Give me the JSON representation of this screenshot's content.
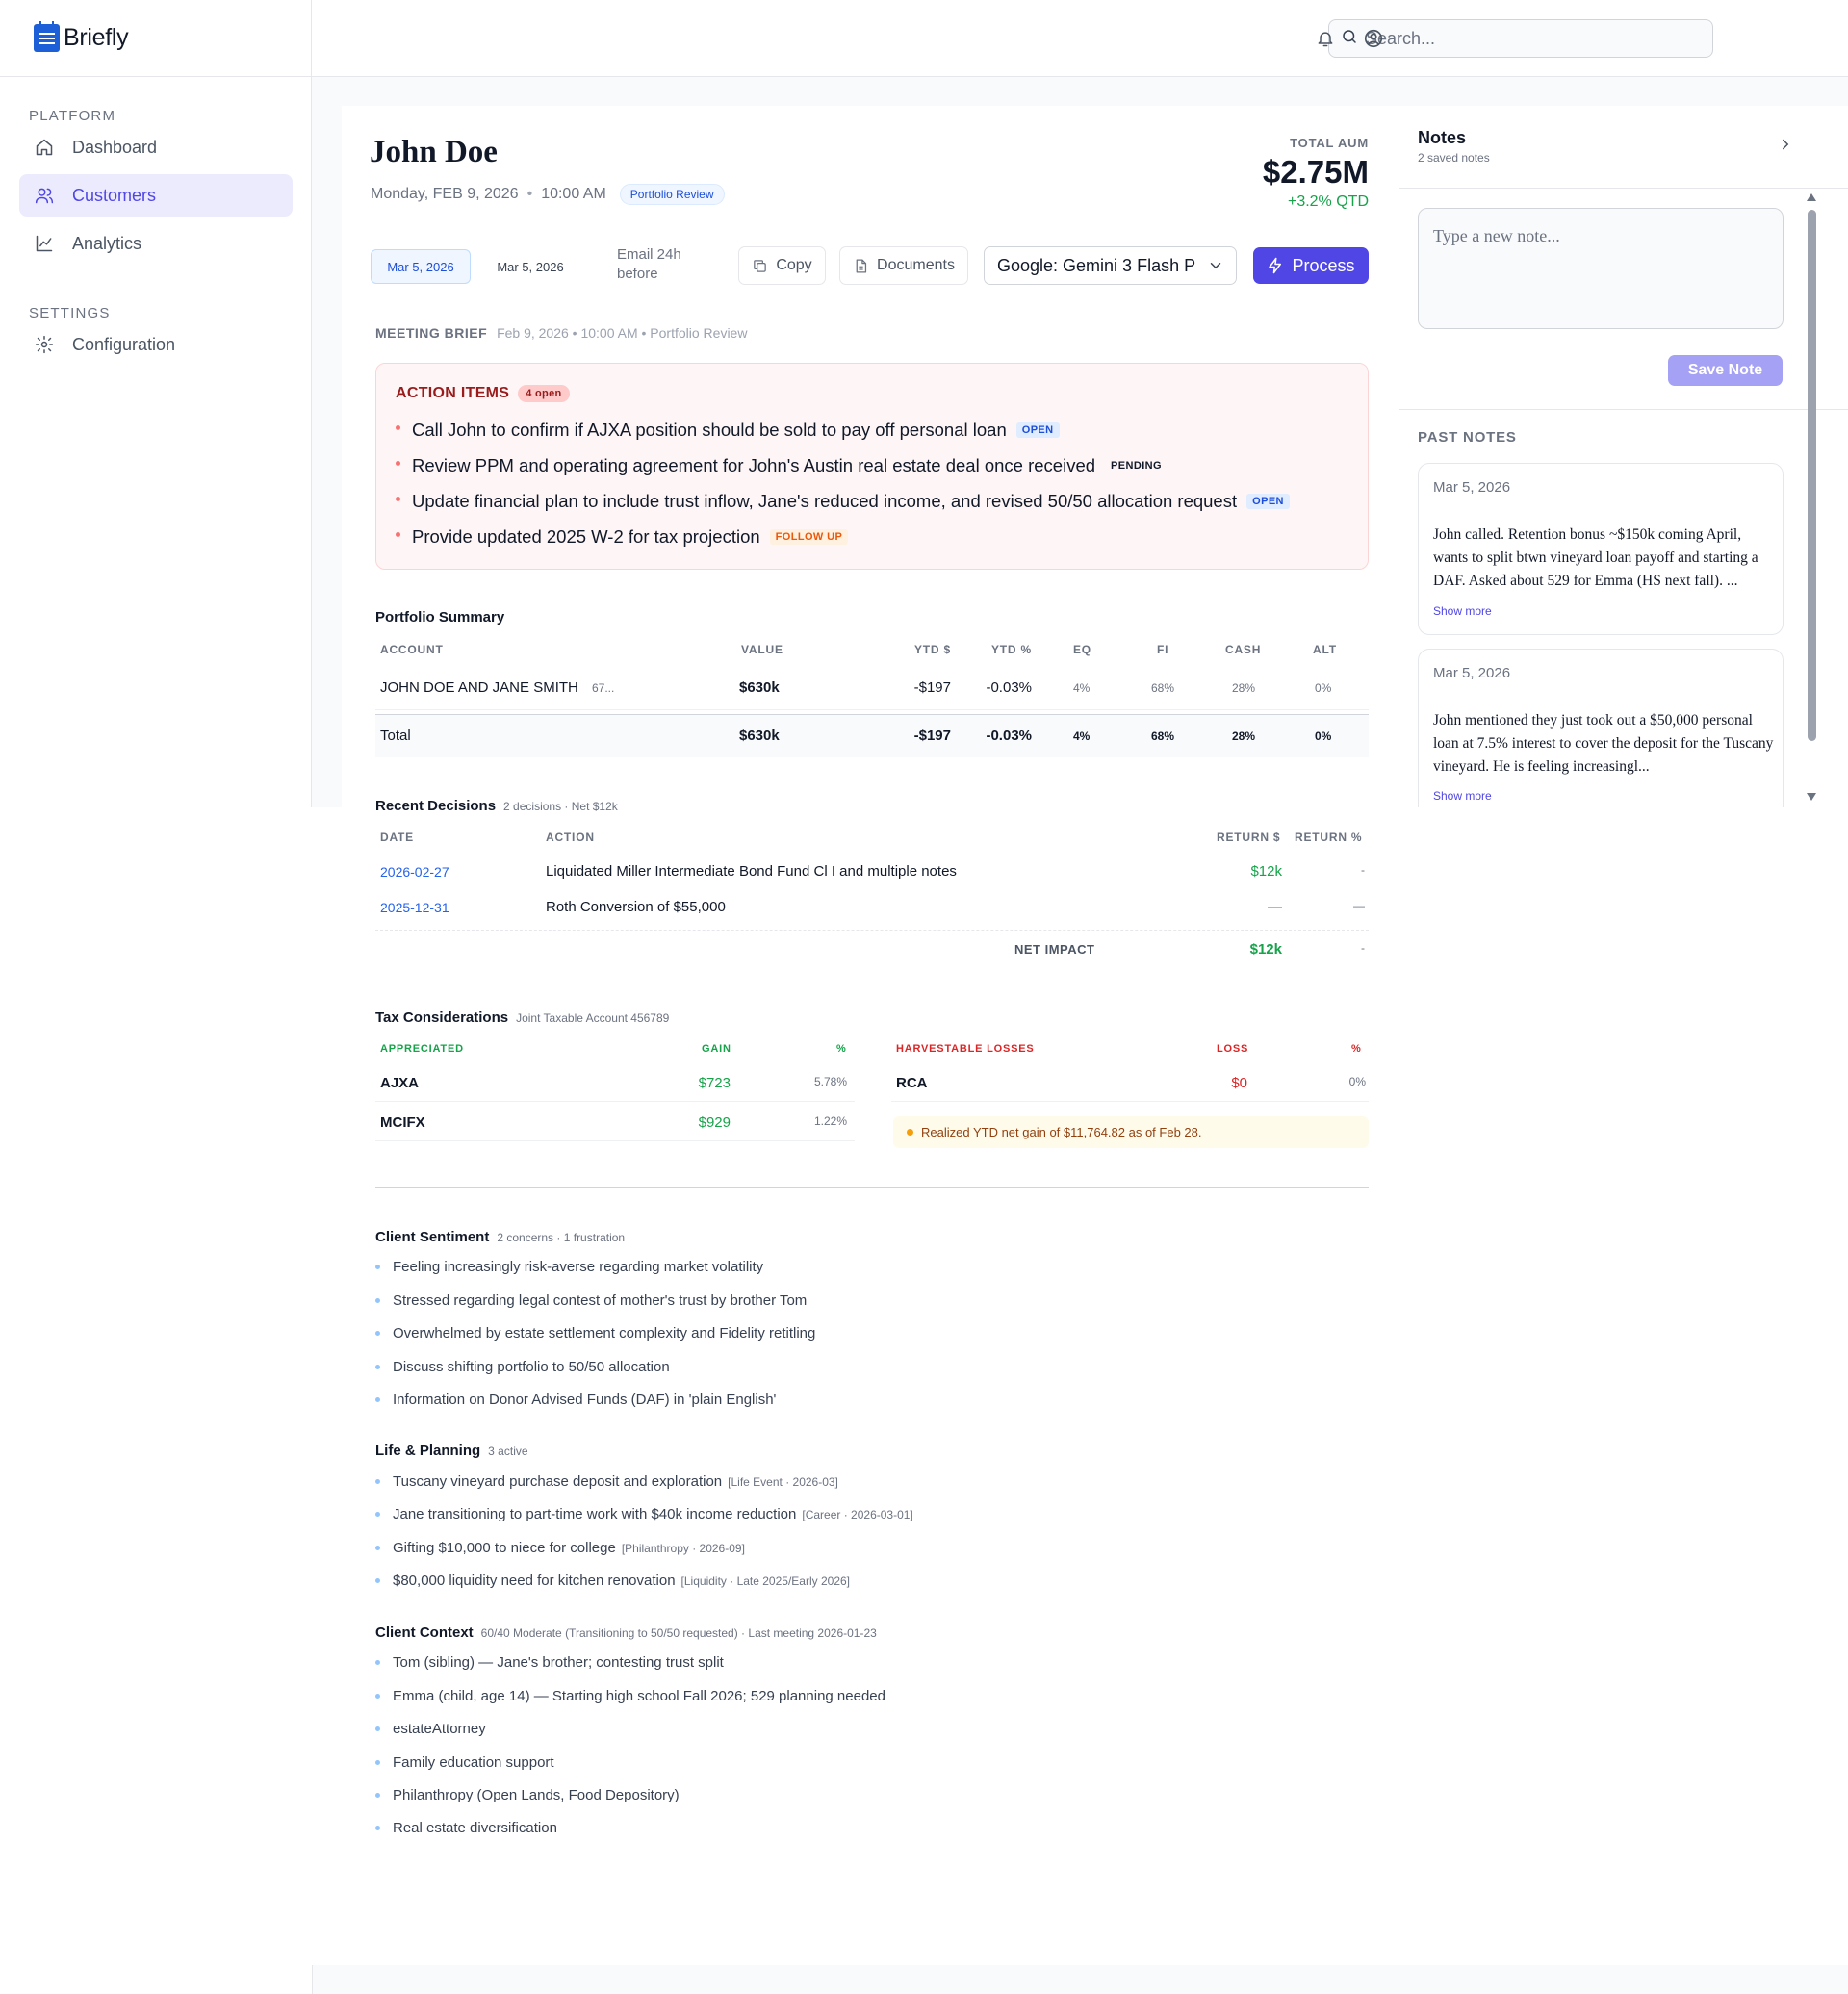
{
  "app": {
    "name": "Briefly"
  },
  "sidebar": {
    "sections": [
      {
        "label": "PLATFORM"
      },
      {
        "label": "SETTINGS"
      }
    ],
    "items": [
      {
        "label": "Dashboard",
        "icon": "home-icon"
      },
      {
        "label": "Customers",
        "icon": "users-icon",
        "active": true
      },
      {
        "label": "Analytics",
        "icon": "chart-line-icon"
      },
      {
        "label": "Configuration",
        "icon": "gear-icon"
      }
    ]
  },
  "topbar": {
    "search_placeholder": "Search..."
  },
  "client": {
    "name": "John Doe",
    "date": "Monday, FEB 9, 2026",
    "time": "10:00 AM",
    "meeting_type": "Portfolio Review",
    "aum_label": "TOTAL AUM",
    "aum_value": "$2.75M",
    "aum_delta": "+3.2% QTD"
  },
  "actions": {
    "date_active": "Mar 5, 2026",
    "date_plain": "Mar 5, 2026",
    "email_note": "Email 24h before",
    "copy_label": "Copy",
    "documents_label": "Documents",
    "model_value": "Google: Gemini 3 Flash P",
    "process_label": "Process"
  },
  "brief": {
    "label": "MEETING BRIEF",
    "details": "Feb 9, 2026 • 10:00 AM • Portfolio Review"
  },
  "action_items": {
    "title": "ACTION ITEMS",
    "count": "4 open",
    "items": [
      {
        "text": "Call John to confirm if AJXA position should be sold to pay off personal loan",
        "tag": "OPEN"
      },
      {
        "text": "Review PPM and operating agreement for John's Austin real estate deal once received",
        "tag": "PENDING"
      },
      {
        "text": "Update financial plan to include trust inflow, Jane's reduced income, and revised 50/50 allocation request",
        "tag": "OPEN"
      },
      {
        "text": "Provide updated 2025 W-2 for tax projection",
        "tag": "FOLLOW UP"
      }
    ]
  },
  "portfolio": {
    "title": "Portfolio Summary",
    "headers": [
      "ACCOUNT",
      "VALUE",
      "YTD $",
      "YTD %",
      "EQ",
      "FI",
      "CASH",
      "ALT"
    ],
    "rows": [
      {
        "account": "JOHN DOE AND JANE SMITH",
        "account_no": "67...",
        "value": "$630k",
        "ytd_d": "-$197",
        "ytd_p": "-0.03%",
        "eq": "4%",
        "fi": "68%",
        "cash": "28%",
        "alt": "0%"
      }
    ],
    "total": {
      "label": "Total",
      "value": "$630k",
      "ytd_d": "-$197",
      "ytd_p": "-0.03%",
      "eq": "4%",
      "fi": "68%",
      "cash": "28%",
      "alt": "0%"
    }
  },
  "decisions": {
    "title": "Recent Decisions",
    "subtitle": "2 decisions · Net $12k",
    "headers": [
      "DATE",
      "ACTION",
      "RETURN $",
      "RETURN %"
    ],
    "rows": [
      {
        "date": "2026-02-27",
        "action": "Liquidated Miller Intermediate Bond Fund Cl I and multiple notes",
        "ret_d": "$12k",
        "ret_p": "-"
      },
      {
        "date": "2025-12-31",
        "action": "Roth Conversion of $55,000",
        "ret_d": "—",
        "ret_p": "—"
      }
    ],
    "net_label": "NET IMPACT",
    "net_d": "$12k",
    "net_p": "-"
  },
  "tax": {
    "title": "Tax Considerations",
    "subtitle": "Joint Taxable Account 456789",
    "appreciated_headers": [
      "APPRECIATED",
      "GAIN",
      "%"
    ],
    "appreciated": [
      {
        "symbol": "AJXA",
        "gain": "$723",
        "pct": "5.78%"
      },
      {
        "symbol": "MCIFX",
        "gain": "$929",
        "pct": "1.22%"
      }
    ],
    "losses_headers": [
      "HARVESTABLE LOSSES",
      "LOSS",
      "%"
    ],
    "losses": [
      {
        "symbol": "RCA",
        "loss": "$0",
        "pct": "0%"
      }
    ],
    "notice": "Realized YTD net gain of $11,764.82 as of Feb 28."
  },
  "sentiment": {
    "title": "Client Sentiment",
    "subtitle": "2 concerns · 1 frustration",
    "items": [
      "Feeling increasingly risk-averse regarding market volatility",
      "Stressed regarding legal contest of mother's trust by brother Tom",
      "Overwhelmed by estate settlement complexity and Fidelity retitling",
      "Discuss shifting portfolio to 50/50 allocation",
      "Information on Donor Advised Funds (DAF) in 'plain English'"
    ]
  },
  "planning": {
    "title": "Life & Planning",
    "subtitle": "3 active",
    "items": [
      {
        "text": "Tuscany vineyard purchase deposit and exploration",
        "meta": "[Life Event · 2026-03]"
      },
      {
        "text": "Jane transitioning to part-time work with $40k income reduction",
        "meta": "[Career · 2026-03-01]"
      },
      {
        "text": "Gifting $10,000 to niece for college",
        "meta": "[Philanthropy · 2026-09]"
      },
      {
        "text": "$80,000 liquidity need for kitchen renovation",
        "meta": "[Liquidity · Late 2025/Early 2026]"
      }
    ]
  },
  "context": {
    "title": "Client Context",
    "subtitle": "60/40 Moderate (Transitioning to 50/50 requested) · Last meeting 2026-01-23",
    "items": [
      "Tom (sibling) — Jane's brother; contesting trust split",
      "Emma (child, age 14) — Starting high school Fall 2026; 529 planning needed",
      "estateAttorney",
      "Family education support",
      "Philanthropy (Open Lands, Food Depository)",
      "Real estate diversification"
    ]
  },
  "notes": {
    "title": "Notes",
    "subtitle": "2 saved notes",
    "input_placeholder": "Type a new note...",
    "save_label": "Save Note",
    "past_label": "PAST NOTES",
    "show_more": "Show more",
    "items": [
      {
        "date": "Mar 5, 2026",
        "text": "John called. Retention bonus ~$150k coming April, wants to split btwn vineyard loan payoff and starting a DAF. Asked about 529 for Emma (HS next fall). ..."
      },
      {
        "date": "Mar 5, 2026",
        "text": "John mentioned they just took out a $50,000 personal loan at 7.5% interest to cover the deposit for the Tuscany vineyard. He is feeling increasingl..."
      }
    ]
  }
}
